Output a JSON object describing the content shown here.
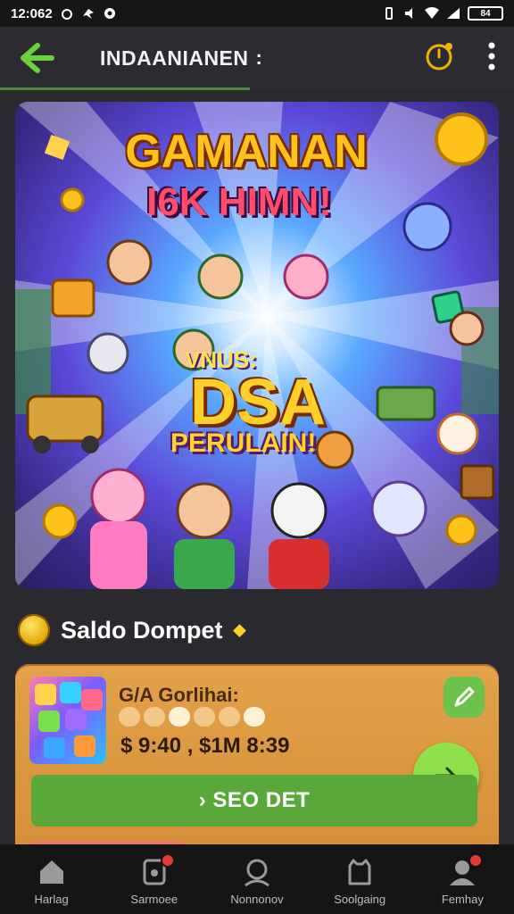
{
  "status_bar": {
    "time": "12:062",
    "battery": "84"
  },
  "app_bar": {
    "title": "INDAANIANEN",
    "title_suffix": ":"
  },
  "hero": {
    "title_line1": "GAMANAN",
    "title_line2": "I6K HIMN!",
    "sub_text": "VNUS:",
    "big_text": "DSA",
    "small_text": "PERULAIN!"
  },
  "section": {
    "title": "Saldo Dompet",
    "mark": "⬥"
  },
  "wallet": {
    "label": "G/A Gorlihai:",
    "amount": "$ 9:40 , $1M 8:39",
    "cta_label": "› SEO DET"
  },
  "bottom_nav": [
    {
      "label": "Harlag",
      "icon": "home-icon",
      "badge": false
    },
    {
      "label": "Sarmoee",
      "icon": "notifications-icon",
      "badge": true
    },
    {
      "label": "Nonnonov",
      "icon": "search-icon",
      "badge": false
    },
    {
      "label": "Soolgaing",
      "icon": "bag-icon",
      "badge": false
    },
    {
      "label": "Femhay",
      "icon": "profile-icon",
      "badge": true
    }
  ],
  "colors": {
    "accent_green": "#5aa83a",
    "card_orange": "#d38b34",
    "coin_gold": "#ffcf2a"
  }
}
